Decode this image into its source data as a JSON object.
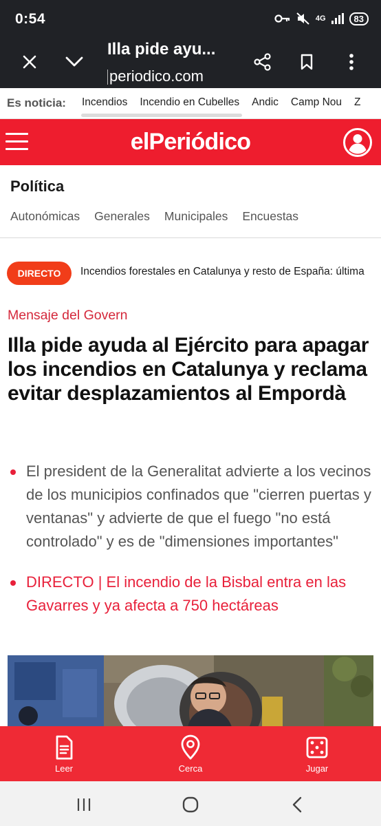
{
  "status": {
    "time": "0:54",
    "network": "4G",
    "battery": "83"
  },
  "browser": {
    "title": "Illa pide ayu...",
    "url": "periodico.com"
  },
  "topics": {
    "label": "Es noticia:",
    "items": [
      "Incendios",
      "Incendio en Cubelles",
      "Andic",
      "Camp Nou",
      "Z"
    ]
  },
  "site": {
    "logo": "elPeriódico"
  },
  "section": {
    "title": "Política",
    "subnav": [
      "Autonómicas",
      "Generales",
      "Municipales",
      "Encuestas"
    ]
  },
  "live": {
    "badge": "DIRECTO",
    "text": "Incendios forestales en Catalunya y resto de España: última"
  },
  "article": {
    "kicker": "Mensaje del Govern",
    "headline": "Illa pide ayuda al Ejército para apagar los incendios en Catalunya y reclama evitar desplazamientos al Empordà",
    "bullets": [
      "El president de la Generalitat advierte a los vecinos de los municipios confinados que \"cierren puertas y ventanas\" y advierte de que el fuego \"no está controlado\" y es de \"dimensiones importantes\"",
      "DIRECTO | El incendio de la Bisbal entra en las Gavarres y ya afecta a 750 hectáreas"
    ]
  },
  "bottom_nav": [
    {
      "label": "Leer",
      "icon": "document-icon"
    },
    {
      "label": "Cerca",
      "icon": "location-pin-icon"
    },
    {
      "label": "Jugar",
      "icon": "dice-icon"
    }
  ],
  "colors": {
    "brand_red": "#ee1d2e",
    "live_orange": "#f13d19",
    "chrome_dark": "#202226"
  }
}
